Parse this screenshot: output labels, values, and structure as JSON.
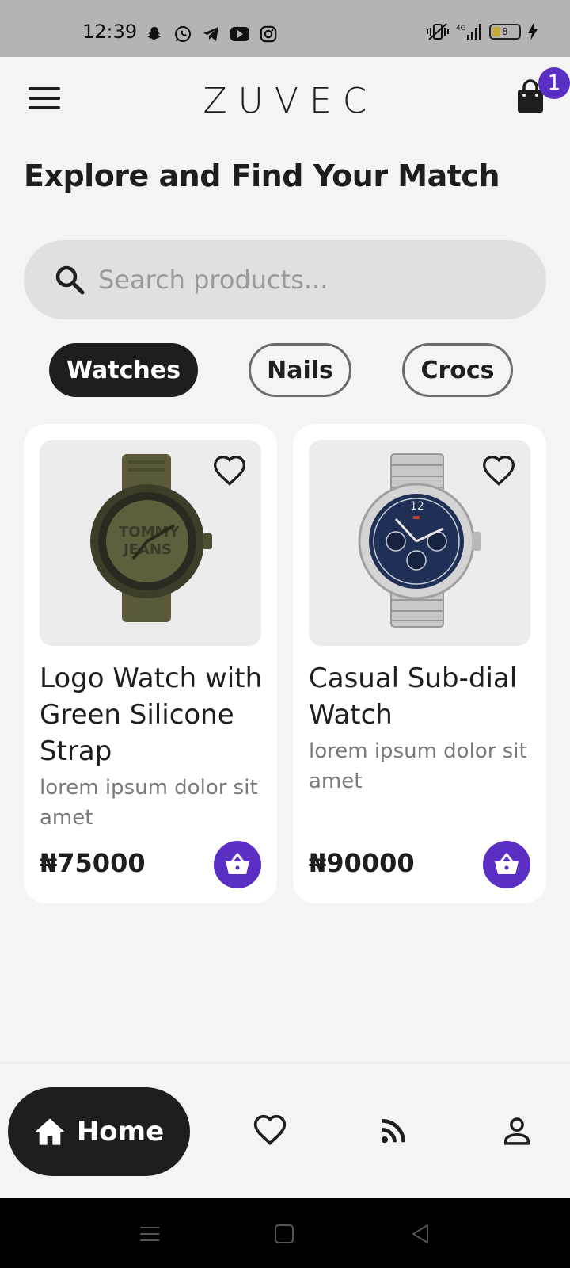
{
  "status": {
    "time": "12:39",
    "battery": "8"
  },
  "header": {
    "brand": "ZUVEC",
    "cart_count": "1"
  },
  "main": {
    "title": "Explore and Find Your Match",
    "search_placeholder": "Search products...",
    "categories": [
      {
        "label": "Watches",
        "active": true
      },
      {
        "label": "Nails",
        "active": false
      },
      {
        "label": "Crocs",
        "active": false
      }
    ],
    "products": [
      {
        "name": "Logo Watch with Green Silicone Strap",
        "description": "lorem ipsum dolor sit amet",
        "price": "₦75000"
      },
      {
        "name": "Casual Sub-dial Watch",
        "description": "lorem ipsum dolor sit amet",
        "price": "₦90000"
      }
    ]
  },
  "bottom_nav": {
    "home_label": "Home"
  },
  "colors": {
    "accent": "#5b2fc4",
    "dark": "#1e1e1e",
    "background": "#f4f4f4"
  }
}
